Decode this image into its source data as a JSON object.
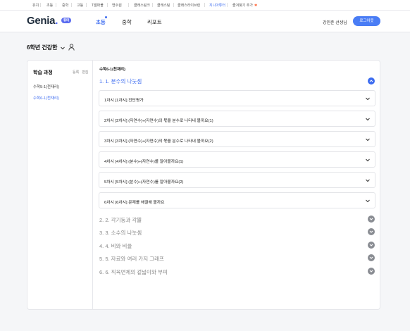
{
  "topnav": {
    "items": [
      "유치",
      "초등",
      "중학",
      "고등",
      "T셀파몰",
      "연수원",
      "클래스링크",
      "클래스팅",
      "클래스라이브런",
      "지니아튜터",
      "즐겨찾기 추가"
    ],
    "active_index": 9
  },
  "header": {
    "logo": "Genia",
    "logo_dot": ".",
    "logo_badge": "튜터",
    "nav": [
      "초등",
      "중학",
      "리포트"
    ],
    "active_nav": "초등",
    "username": "강민준 선생님",
    "logout_label": "로그아웃"
  },
  "student": {
    "name": "6학년 건강한",
    "icons": [
      "chevron-down-icon",
      "person-icon"
    ]
  },
  "sidebar": {
    "title": "학습 과정",
    "actions": [
      "등록",
      "편집"
    ],
    "courses": [
      {
        "label": "수학5-1(천재리)",
        "active": false
      },
      {
        "label": "수학6-1(천재리)",
        "active": true
      }
    ]
  },
  "content": {
    "course_title": "수학6-1(천재리)",
    "open_unit": "1. 1. 분수의 나눗셈",
    "lessons": [
      "1차시 [1차시] 진단평가",
      "2차시 [2차시] (자연수)÷(자연수)의 몫을 분수로 나타내 볼까요(1)",
      "3차시 [3차시] (자연수)÷(자연수)의 몫을 분수로 나타내 볼까요(2)",
      "4차시 [4차시] (분수)÷(자연수)를 알아볼까요(1)",
      "5차시 [5차시] (분수)÷(자연수)를 알아볼까요(2)",
      "6차시 [6차시] 문제를 해결해 볼까요"
    ],
    "units": [
      "2. 2. 각기둥과 각뿔",
      "3. 3. 소수의 나눗셈",
      "4. 4. 비와 비율",
      "5. 5. 자료와 여러 가지 그래프",
      "6. 6. 직육면체의 겉넓이와 부피"
    ]
  },
  "colors": {
    "accent": "#3d6cf0",
    "logout_bg": "#4a7df5",
    "collapsed_btn": "#8a8d93"
  }
}
